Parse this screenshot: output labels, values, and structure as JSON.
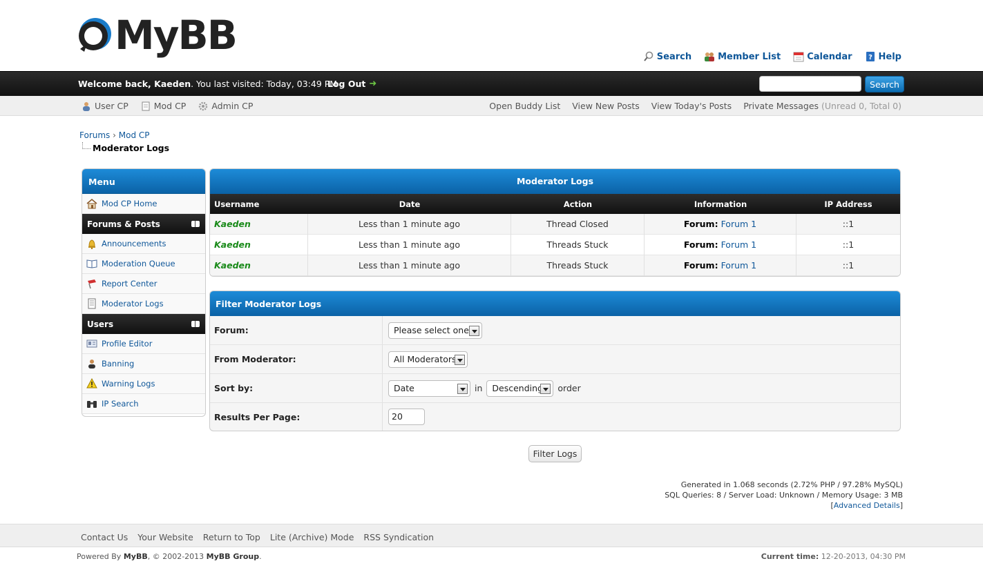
{
  "header": {
    "brand": "MyBB",
    "top_links": [
      "Search",
      "Member List",
      "Calendar",
      "Help"
    ]
  },
  "panel": {
    "welcome_prefix": "Welcome back, ",
    "username": "Kaeden",
    "last_visit": ". You last visited: Today, 03:49 PM",
    "logout": "Log Out",
    "search_value": "",
    "search_button": "Search"
  },
  "user_bar": {
    "left": [
      "User CP",
      "Mod CP",
      "Admin CP"
    ],
    "right": [
      "Open Buddy List",
      "View New Posts",
      "View Today's Posts"
    ],
    "pm_label": "Private Messages",
    "pm_counts": "(Unread 0, Total 0)"
  },
  "breadcrumb": {
    "items": [
      "Forums",
      "Mod CP"
    ],
    "separator": "›",
    "current": "Moderator Logs"
  },
  "menu": {
    "title": "Menu",
    "home": "Mod CP Home",
    "sections": [
      {
        "title": "Forums & Posts",
        "items": [
          "Announcements",
          "Moderation Queue",
          "Report Center",
          "Moderator Logs"
        ]
      },
      {
        "title": "Users",
        "items": [
          "Profile Editor",
          "Banning",
          "Warning Logs",
          "IP Search"
        ]
      }
    ]
  },
  "logs": {
    "title": "Moderator Logs",
    "columns": [
      "Username",
      "Date",
      "Action",
      "Information",
      "IP Address"
    ],
    "info_label": "Forum:",
    "rows": [
      {
        "username": "Kaeden",
        "date": "Less than 1 minute ago",
        "action": "Thread Closed",
        "forum": "Forum 1",
        "ip": "::1"
      },
      {
        "username": "Kaeden",
        "date": "Less than 1 minute ago",
        "action": "Threads Stuck",
        "forum": "Forum 1",
        "ip": "::1"
      },
      {
        "username": "Kaeden",
        "date": "Less than 1 minute ago",
        "action": "Threads Stuck",
        "forum": "Forum 1",
        "ip": "::1"
      }
    ]
  },
  "filter": {
    "title": "Filter Moderator Logs",
    "forum_label": "Forum:",
    "forum_value": "Please select one:",
    "moderator_label": "From Moderator:",
    "moderator_value": "All Moderators",
    "sort_label": "Sort by:",
    "sort_value": "Date",
    "in_text": "in",
    "order_value": "Descending",
    "order_text": "order",
    "per_page_label": "Results Per Page:",
    "per_page_value": "20",
    "submit": "Filter Logs"
  },
  "debug": {
    "line1": "Generated in 1.068 seconds (2.72% PHP / 97.28% MySQL)",
    "line2": "SQL Queries: 8 / Server Load: Unknown / Memory Usage: 3 MB",
    "advanced": "Advanced Details"
  },
  "footer": {
    "links": [
      "Contact Us",
      "Your Website",
      "Return to Top",
      "Lite (Archive) Mode",
      "RSS Syndication"
    ],
    "powered_prefix": "Powered By ",
    "powered_brand": "MyBB",
    "powered_mid": ", © 2002-2013 ",
    "powered_group": "MyBB Group",
    "current_time_label": "Current time:",
    "current_time": "12-20-2013, 04:30 PM"
  },
  "colors": {
    "accent_blue": "#0b62a6",
    "link": "#0f5799",
    "username_green": "#1a8a1a",
    "dark_bar": "#111111"
  }
}
